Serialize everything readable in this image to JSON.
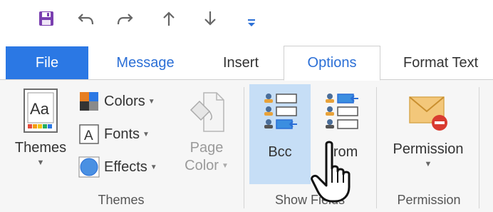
{
  "qat": {
    "icons": [
      "save-icon",
      "undo-icon",
      "redo-icon",
      "up-arrow-icon",
      "down-arrow-icon",
      "customize-qat-icon"
    ]
  },
  "tabs": {
    "file": "File",
    "message": "Message",
    "insert": "Insert",
    "options": "Options",
    "format_text": "Format Text"
  },
  "ribbon": {
    "themes_group": {
      "themes_button": "Themes",
      "colors": "Colors",
      "fonts": "Fonts",
      "effects": "Effects",
      "page_color_line1": "Page",
      "page_color_line2": "Color",
      "label": "Themes"
    },
    "show_fields_group": {
      "bcc": "Bcc",
      "from": "From",
      "label": "Show Fields"
    },
    "permission_group": {
      "permission": "Permission",
      "label": "Permission"
    }
  },
  "colors": {
    "file_tab_bg": "#2b78e4",
    "accent_text": "#2b6fd6",
    "bcc_highlight": "#c6def6",
    "ribbon_bg": "#f6f6f6"
  }
}
